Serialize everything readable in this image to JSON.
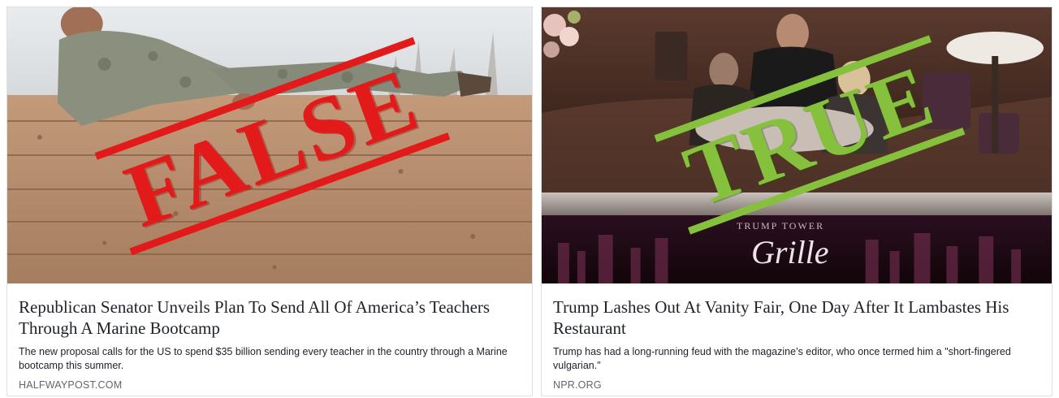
{
  "cards": [
    {
      "stamp": "FALSE",
      "headline": "Republican Senator Unveils Plan To Send All Of America’s Teachers Through A Marine Bootcamp",
      "description": "The new proposal calls for the US to spend $35 billion sending every teacher in the country through a Marine bootcamp this summer.",
      "source": "HALFWAYPOST.COM"
    },
    {
      "stamp": "TRUE",
      "sign_small": "TRUMP TOWER",
      "sign_large": "Grille",
      "headline": "Trump Lashes Out At Vanity Fair, One Day After It Lambastes His Restaurant",
      "description": "Trump has had a long-running feud with the magazine’s editor, who once termed him a \"short-fingered vulgarian.\"",
      "source": "NPR.ORG"
    }
  ],
  "colors": {
    "false_stamp": "#e21a1a",
    "true_stamp": "#86c13d",
    "headline_text": "#1d2129",
    "source_text": "#606770",
    "card_border": "#dddfe2"
  }
}
